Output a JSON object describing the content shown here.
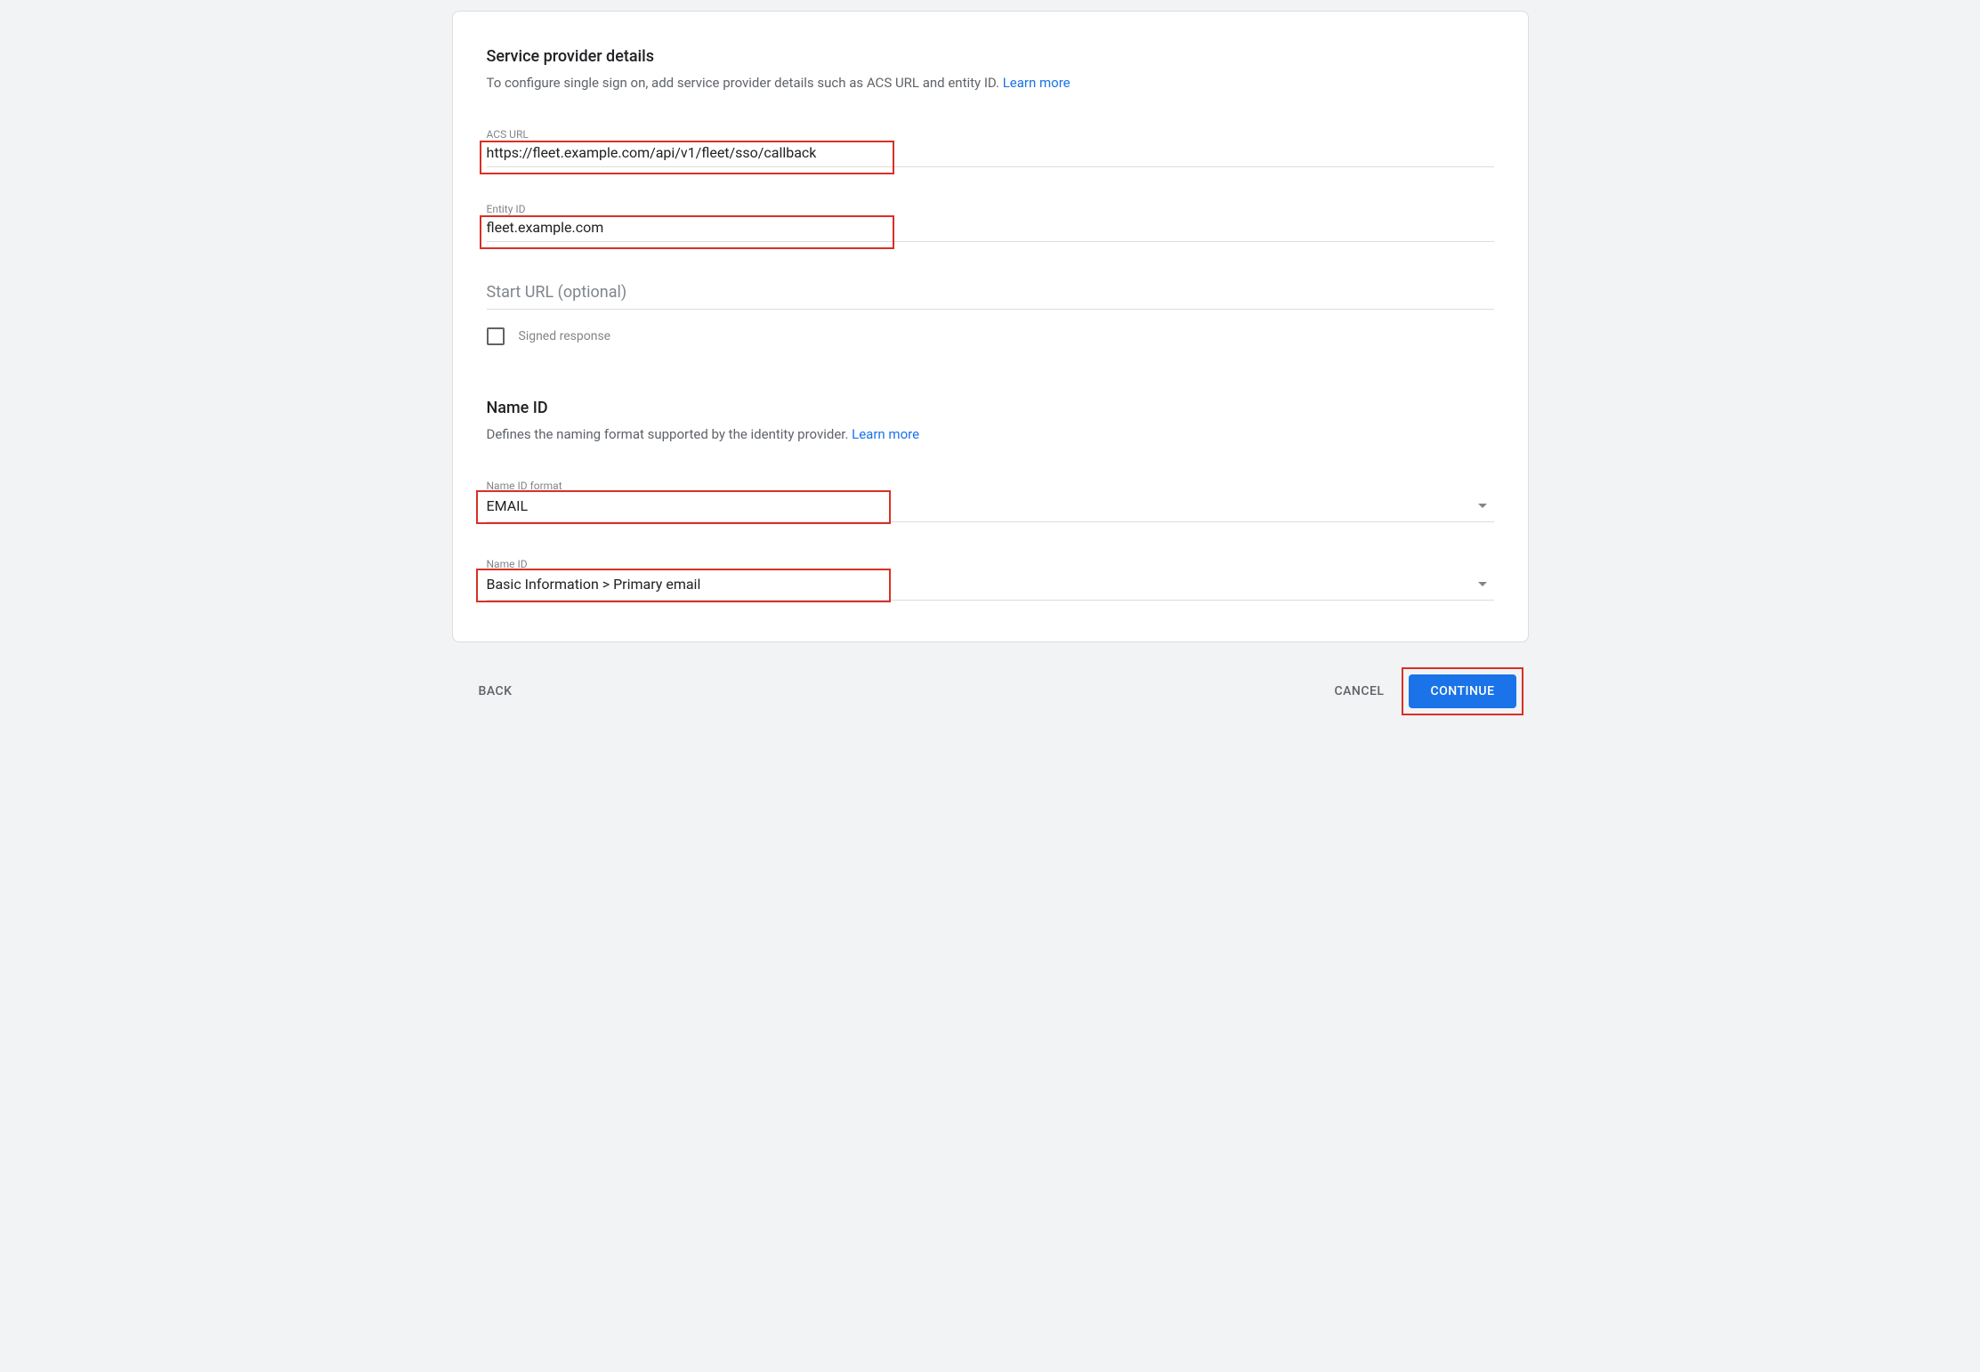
{
  "sp": {
    "title": "Service provider details",
    "desc": "To configure single sign on, add service provider details such as ACS URL and entity ID. ",
    "learn": "Learn more",
    "acs_label": "ACS URL",
    "acs_value": "https://fleet.example.com/api/v1/fleet/sso/callback",
    "entity_label": "Entity ID",
    "entity_value": "fleet.example.com",
    "start_placeholder": "Start URL (optional)",
    "signed_label": "Signed response"
  },
  "nameid": {
    "title": "Name ID",
    "desc": "Defines the naming format supported by the identity provider. ",
    "learn": "Learn more",
    "format_label": "Name ID format",
    "format_value": "EMAIL",
    "id_label": "Name ID",
    "id_value": "Basic Information > Primary email"
  },
  "buttons": {
    "back": "Back",
    "cancel": "Cancel",
    "continue": "Continue"
  }
}
